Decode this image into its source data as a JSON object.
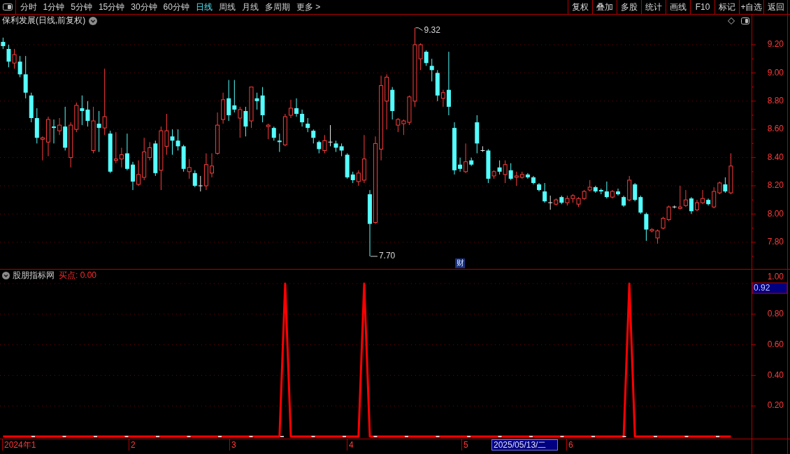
{
  "toolbar": {
    "periods": [
      {
        "label": "分时",
        "selected": false
      },
      {
        "label": "1分钟",
        "selected": false
      },
      {
        "label": "5分钟",
        "selected": false
      },
      {
        "label": "15分钟",
        "selected": false
      },
      {
        "label": "30分钟",
        "selected": false
      },
      {
        "label": "60分钟",
        "selected": false
      },
      {
        "label": "日线",
        "selected": true
      },
      {
        "label": "周线",
        "selected": false
      },
      {
        "label": "月线",
        "selected": false
      },
      {
        "label": "多周期",
        "selected": false
      },
      {
        "label": "更多 >",
        "selected": false
      }
    ],
    "actions": [
      "复权",
      "叠加",
      "多股",
      "统计",
      "画线",
      "F10",
      "标记",
      "+自选",
      "返回"
    ]
  },
  "main_chart": {
    "title": "保利发展(日线,前复权)",
    "price_axis": [
      "9.20",
      "9.00",
      "8.80",
      "8.60",
      "8.40",
      "8.20",
      "8.00",
      "7.80"
    ],
    "annotations": [
      {
        "kind": "high",
        "label": "9.32"
      },
      {
        "kind": "low",
        "label": "7.70"
      }
    ],
    "event_marker": "财"
  },
  "indicator": {
    "name": "股朋指标网",
    "legend": "买点: 0.00",
    "cursor_value": "0.92",
    "chart_data": {
      "type": "line",
      "grid": true,
      "ylim": [
        0,
        1
      ],
      "yticks": [
        {
          "value": 0.2,
          "label": "0.20"
        },
        {
          "value": 0.4,
          "label": "0.40"
        },
        {
          "value": 0.6,
          "label": "0.60"
        },
        {
          "value": 0.8,
          "label": "0.80"
        },
        {
          "value": 1,
          "label": "1.00"
        }
      ],
      "series": [
        {
          "color": "#ff0000",
          "values": [
            0,
            0,
            0,
            0,
            0,
            0,
            0,
            0,
            0,
            0,
            0,
            0,
            0,
            0,
            0,
            0,
            0,
            0,
            0,
            0,
            0,
            0,
            0,
            0,
            0,
            0,
            0,
            0,
            0,
            0,
            0,
            0,
            0,
            0,
            0,
            0,
            0,
            0,
            0,
            0,
            0,
            0,
            0,
            0,
            0,
            0,
            0,
            0,
            0,
            0,
            1,
            0,
            0,
            0,
            0,
            0,
            0,
            0,
            0,
            0,
            0,
            0,
            0,
            0,
            1,
            0,
            0,
            0,
            0,
            0,
            0,
            0,
            0,
            0,
            0,
            0,
            0,
            0,
            0,
            0,
            0,
            0,
            0,
            0,
            0,
            0,
            0,
            0,
            0,
            0,
            0,
            0,
            0,
            0,
            0,
            0,
            0,
            0,
            0,
            0,
            0,
            0,
            0,
            0,
            0,
            0,
            0,
            0,
            0,
            0,
            0,
            1,
            0,
            0,
            0,
            0,
            0,
            0,
            0,
            0,
            0,
            0,
            0,
            0,
            0,
            0,
            0,
            0,
            0,
            0
          ]
        }
      ]
    }
  },
  "time_axis": {
    "labels": [
      "2024年1",
      "2",
      "3",
      "4",
      "5",
      "6"
    ],
    "cursor_date": "2025/05/13/二"
  }
}
